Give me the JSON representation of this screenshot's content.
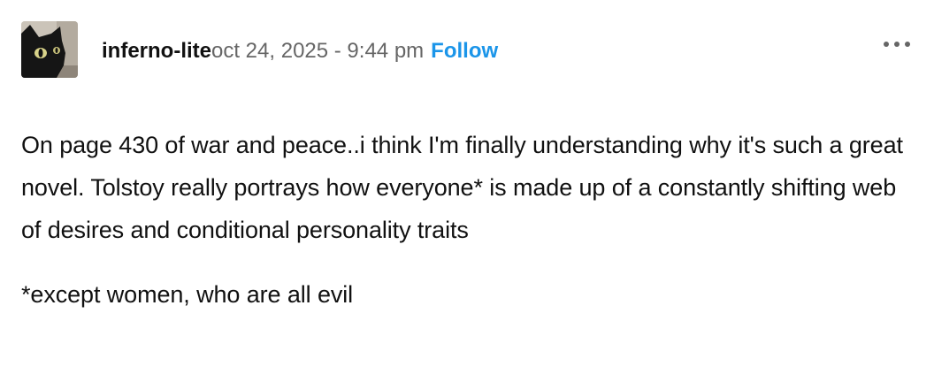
{
  "post": {
    "author": {
      "username": "inferno-lite",
      "avatar_icon": "black-cat-avatar"
    },
    "timestamp": "oct 24, 2025 - 9:44 pm",
    "follow_label": "Follow",
    "more_icon": "ellipsis-icon",
    "body": [
      "On page 430 of war and peace..i think I'm finally understanding why it's such a great novel. Tolstoy really portrays how everyone* is made up of a constantly shifting web of desires and conditional personality traits",
      "*except women, who are all evil"
    ]
  },
  "colors": {
    "accent": "#1b95e9",
    "text": "#111111",
    "muted": "#666666",
    "background": "#ffffff"
  }
}
